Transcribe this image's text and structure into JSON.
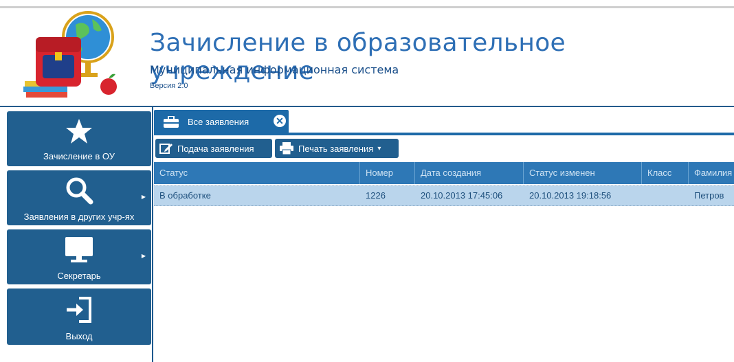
{
  "header": {
    "title": "Зачисление в образовательное учреждение",
    "subtitle": "Муниципальная информационная система",
    "version": "Версия 2.0"
  },
  "sidebar": {
    "items": [
      {
        "label": "Зачисление в ОУ",
        "icon": "star-icon",
        "has_submenu": false
      },
      {
        "label": "Заявления в других учр-ях",
        "icon": "search-icon",
        "has_submenu": true
      },
      {
        "label": "Секретарь",
        "icon": "monitor-icon",
        "has_submenu": true
      },
      {
        "label": "Выход",
        "icon": "exit-icon",
        "has_submenu": false
      }
    ]
  },
  "tabs": [
    {
      "label": "Все заявления",
      "icon": "briefcase-icon",
      "close_icon": "close-circle-icon",
      "close_glyph": "✕"
    }
  ],
  "toolbar": {
    "submit_label": "Подача заявления",
    "print_label": "Печать заявления",
    "print_caret": "▾"
  },
  "grid": {
    "columns": [
      "Статус",
      "Номер",
      "Дата создания",
      "Статус изменен",
      "Класс",
      "Фамилия"
    ],
    "rows": [
      [
        "В обработке",
        "1226",
        "20.10.2013 17:45:06",
        "20.10.2013 19:18:56",
        "",
        "Петров"
      ]
    ]
  },
  "colors": {
    "accent": "#215f8f",
    "header_title": "#2e6fb5",
    "grid_header": "#2e78b6",
    "selected_row": "#bad5ec"
  }
}
